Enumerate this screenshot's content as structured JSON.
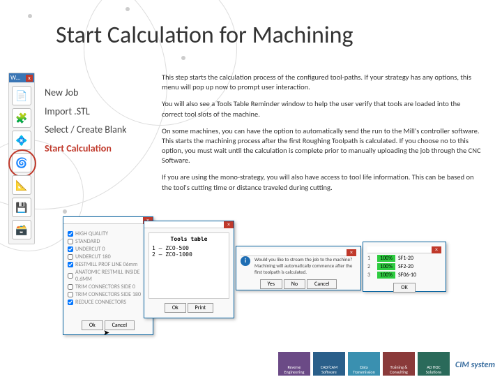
{
  "title": "Start Calculation for Machining",
  "toolbar": {
    "label": "W…",
    "close": "x"
  },
  "nav": {
    "items": [
      {
        "label": "New Job"
      },
      {
        "label": "Import .STL"
      },
      {
        "label": "Select / Create Blank"
      },
      {
        "label": "Start Calculation",
        "current": true
      }
    ]
  },
  "paragraphs": [
    "This step starts the calculation process of the configured tool-paths. If your strategy has any options, this menu will pop up now to prompt user interaction.",
    "You will also see a Tools Table Reminder window to help the user verify that tools are loaded into the correct tool slots of the machine.",
    "On some machines, you can have the option to automatically send the run to the Mill's controller software. This starts the machining process after the first Roughing Toolpath is calculated. If you choose no to this option, you must wait until the calculation is complete prior to manually uploading the job through the CNC Software.",
    "If you are using the mono-strategy, you will also have access to tool life information. This can be based on the tool's cutting time or distance traveled during cutting."
  ],
  "win1": {
    "options": [
      {
        "label": "HIGH QUALITY",
        "checked": true
      },
      {
        "label": "STANDARD",
        "checked": false
      },
      {
        "label": "UNDERCUT 0",
        "checked": true
      },
      {
        "label": "UNDERCUT 180",
        "checked": false
      },
      {
        "label": "RESTMILL PROF LINE 06mm",
        "checked": true
      },
      {
        "label": "ANATOMIC RESTMILL INSIDE 0.6MM",
        "checked": false
      },
      {
        "label": "TRIM CONNECTORS SIDE 0",
        "checked": false
      },
      {
        "label": "TRIM CONNECTORS SIDE 180",
        "checked": false
      },
      {
        "label": "REDUCE CONNECTORS",
        "checked": true
      }
    ],
    "ok": "Ok",
    "cancel": "Cancel"
  },
  "win2": {
    "title": "Tools table",
    "lines": [
      "1 – ZCO-500",
      "2 – ZCO-1000"
    ],
    "ok": "Ok",
    "print": "Print"
  },
  "win3": {
    "message": "Would you like to stream the job to the machine? Machining will automatically commence after the first toolpath is calculated.",
    "yes": "Yes",
    "no": "No",
    "cancel": "Cancel"
  },
  "win4": {
    "rows": [
      {
        "n": "1",
        "pct": "100%",
        "name": "SF1-20"
      },
      {
        "n": "2",
        "pct": "100%",
        "name": "SF2-20"
      },
      {
        "n": "3",
        "pct": "100%",
        "name": "SF06-10"
      }
    ],
    "ok": "OK"
  },
  "footer": {
    "cards": [
      {
        "label": "Reverse Engineering",
        "color": "#6b4a86"
      },
      {
        "label": "CAD/CAM Software",
        "color": "#2a5f8a"
      },
      {
        "label": "Data Transmission",
        "color": "#3a90b0"
      },
      {
        "label": "Training & Consulting",
        "color": "#8a3a3a"
      },
      {
        "label": "AD HOC Solutions",
        "color": "#2a6a5a"
      }
    ],
    "logo": "CIM system"
  }
}
